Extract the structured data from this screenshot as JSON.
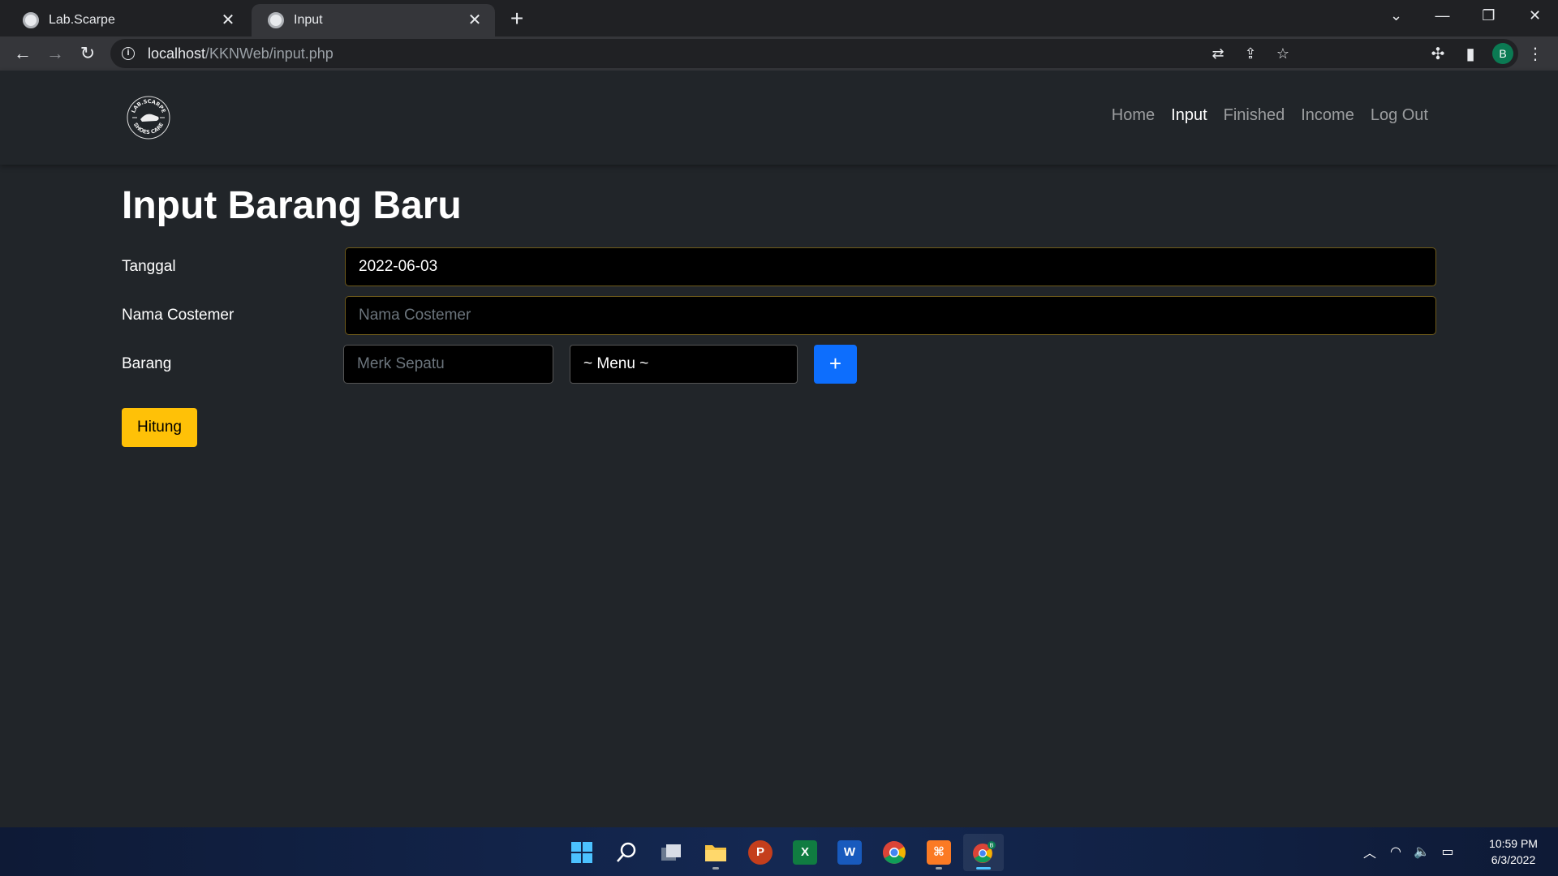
{
  "browser": {
    "tabs": [
      {
        "title": "Lab.Scarpe",
        "active": false
      },
      {
        "title": "Input",
        "active": true
      }
    ],
    "address": {
      "host": "localhost",
      "path": "/KKNWeb/input.php"
    }
  },
  "site": {
    "logo_text": "LAB.SCARPE SHOES CARE",
    "nav": [
      "Home",
      "Input",
      "Finished",
      "Income",
      "Log Out"
    ],
    "active_nav": "Input"
  },
  "form": {
    "title": "Input Barang Baru",
    "tanggal": {
      "label": "Tanggal",
      "value": "2022-06-03"
    },
    "nama": {
      "label": "Nama Costemer",
      "placeholder": "Nama Costemer"
    },
    "barang": {
      "label": "Barang",
      "merk_placeholder": "Merk Sepatu",
      "menu_selected": "~ Menu ~",
      "add_label": "+"
    },
    "submit_label": "Hitung"
  },
  "taskbar": {
    "apps": [
      "start",
      "search",
      "task-view",
      "file-explorer",
      "powerpoint",
      "excel",
      "word",
      "chrome",
      "xampp",
      "chrome-profile"
    ],
    "time": "10:59 PM",
    "date": "6/3/2022"
  },
  "colors": {
    "page_bg": "#212529",
    "primary": "#0d6efd",
    "warning": "#ffc107"
  }
}
